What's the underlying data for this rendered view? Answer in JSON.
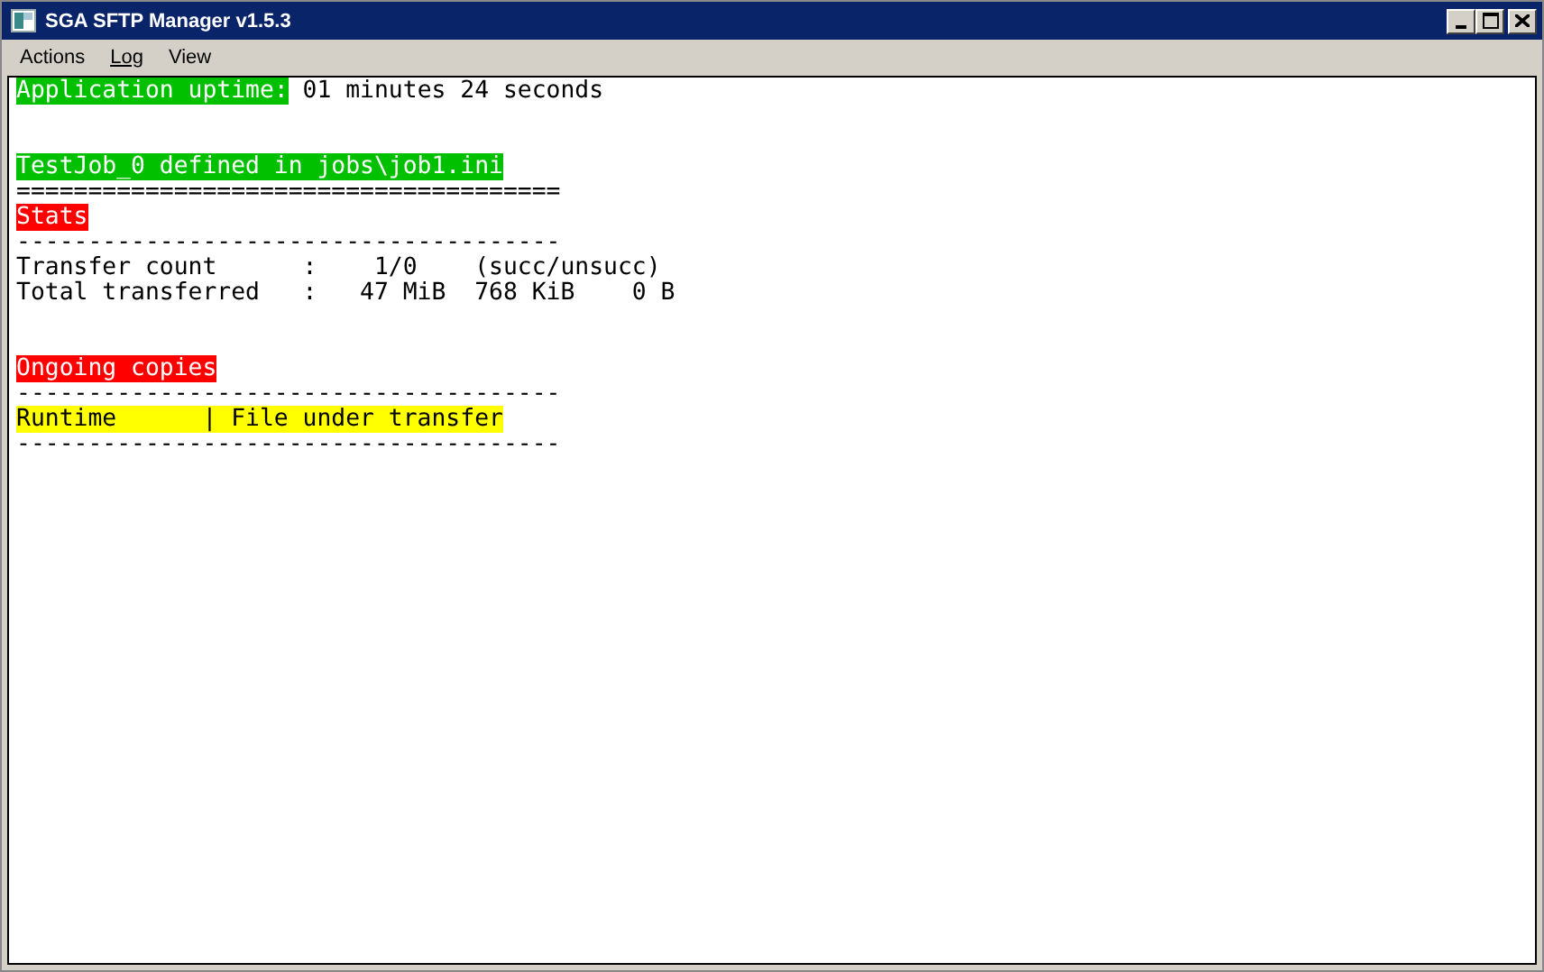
{
  "window": {
    "title": "SGA SFTP Manager v1.5.3"
  },
  "menu": [
    {
      "label": "Actions",
      "mnemonic_underlined": false
    },
    {
      "label": "Log",
      "mnemonic_underlined": true
    },
    {
      "label": "View",
      "mnemonic_underlined": false
    }
  ],
  "console": [
    {
      "kind": "text",
      "segments": [
        {
          "text": "Application uptime:",
          "color": "#00c000"
        },
        {
          "text": " 01 minutes 24 seconds"
        }
      ]
    },
    {
      "kind": "blank"
    },
    {
      "kind": "blank"
    },
    {
      "kind": "text",
      "segments": [
        {
          "text": "TestJob_0 defined in jobs\\job1.ini",
          "color": "#00c000"
        }
      ]
    },
    {
      "kind": "text",
      "segments": [
        {
          "text": "======================================"
        }
      ]
    },
    {
      "kind": "text",
      "segments": [
        {
          "text": "Stats",
          "color": "#ff0000"
        }
      ]
    },
    {
      "kind": "text",
      "segments": [
        {
          "text": "--------------------------------------"
        }
      ]
    },
    {
      "kind": "text",
      "segments": [
        {
          "text": "Transfer count      :    1/0    (succ/unsucc)"
        }
      ]
    },
    {
      "kind": "text",
      "segments": [
        {
          "text": "Total transferred   :   47 MiB  768 KiB    0 B"
        }
      ]
    },
    {
      "kind": "blank"
    },
    {
      "kind": "blank"
    },
    {
      "kind": "text",
      "segments": [
        {
          "text": "Ongoing copies",
          "color": "#ff0000"
        }
      ]
    },
    {
      "kind": "text",
      "segments": [
        {
          "text": "--------------------------------------"
        }
      ]
    },
    {
      "kind": "text",
      "segments": [
        {
          "text": "Runtime      | File under transfer",
          "color": "#ffff00"
        }
      ]
    },
    {
      "kind": "text",
      "segments": [
        {
          "text": "--------------------------------------"
        }
      ]
    }
  ]
}
